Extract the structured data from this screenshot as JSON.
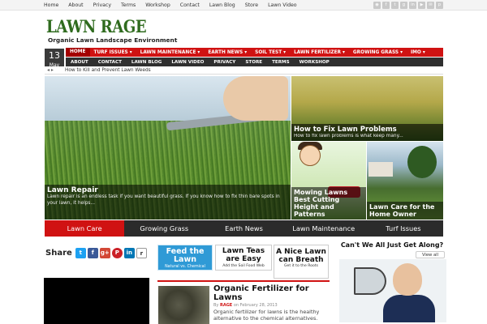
{
  "topbar": {
    "links": [
      "Home",
      "About",
      "Privacy",
      "Terms",
      "Workshop",
      "Contact",
      "Lawn Blog",
      "Store",
      "Lawn Video"
    ],
    "social_icons": [
      "rss-icon",
      "facebook-icon",
      "twitter-icon",
      "googleplus-icon",
      "linkedin-icon",
      "youtube-icon",
      "email-icon",
      "pinterest-icon"
    ]
  },
  "header": {
    "logo": "LAWN RAGE",
    "tagline": "Organic Lawn  Landscape  Environment"
  },
  "date": {
    "day": "13",
    "month": "May"
  },
  "nav_primary": [
    "HOME",
    "TURF ISSUES ▾",
    "LAWN MAINTENANCE ▾",
    "EARTH NEWS ▾",
    "SOIL TEST ▾",
    "LAWN FERTILIZER ▾",
    "GROWING GRASS ▾",
    "IMO ▾"
  ],
  "nav_secondary": [
    "ABOUT",
    "CONTACT",
    "LAWN BLOG",
    "LAWN VIDEO",
    "PRIVACY",
    "STORE",
    "TERMS",
    "WORKSHOP"
  ],
  "ticker": {
    "arrows": "◂ ▸",
    "text": "How to Kill and Prevent Lawn Weeds"
  },
  "slider": {
    "main": {
      "title": "Lawn Repair",
      "excerpt": "Lawn repair is an endless task if you want beautiful grass.  If you know how to fix thin bare spots in your lawn, it helps..."
    },
    "right_top": {
      "title": "How to Fix Lawn Problems",
      "excerpt": "How to fix lawn problems is what keep many..."
    },
    "right_mid": {
      "title": "Mowing Lawns Best Cutting Height and Patterns"
    },
    "right_end": {
      "title": "Lawn Care for the Home Owner"
    },
    "tabs": [
      "Lawn Care",
      "Growing Grass",
      "Earth News",
      "Lawn Maintenance",
      "Turf Issues"
    ],
    "active_tab": "Lawn Care"
  },
  "share": {
    "label": "Share",
    "icons": [
      "t",
      "f",
      "g+",
      "P",
      "in",
      "r"
    ]
  },
  "promos": [
    {
      "big": "Feed the Lawn",
      "small": "Natural vs. Chemical"
    },
    {
      "big": "Lawn Teas are Easy",
      "small": "Add the Soil Food Web"
    },
    {
      "big": "A Nice Lawn can Breath",
      "small": "Get it to the Roots"
    }
  ],
  "article": {
    "title": "Organic Fertilizer for Lawns",
    "author": "RAGE",
    "meta_rest": "on February 28, 2013",
    "excerpt": "Organic fertilizer for lawns is the healthy alternative to the chemical alternatives."
  },
  "sidebar": {
    "title": "Can't We All Just Get Along?",
    "button": "View all"
  },
  "colors": {
    "brand_green": "#2f6b1e",
    "nav_red": "#d01212",
    "nav_dark": "#2f2f2f",
    "promo_blue": "#2f9ad6"
  }
}
